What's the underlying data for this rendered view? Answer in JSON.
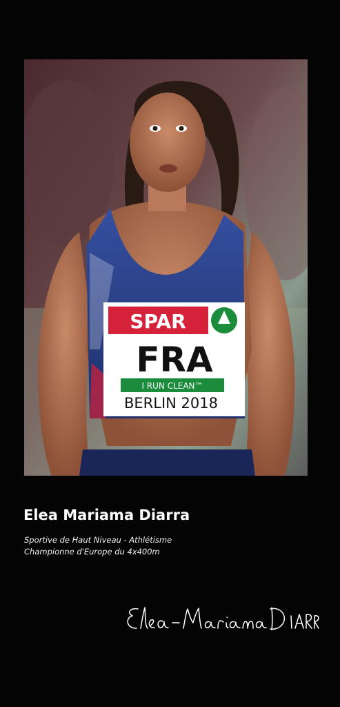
{
  "athlete": {
    "name": "Elea Mariama Diarra",
    "subtitle_line1": "Sportive de Haut Niveau - Athlétisme",
    "subtitle_line2": "Championne d'Europe du 4x400m"
  },
  "photo": {
    "description_icon": "athlete-portrait-image",
    "bib": {
      "sponsor": "SPAR",
      "country": "FRA",
      "slogan": "I RUN CLEAN™",
      "event": "BERLIN 2018"
    }
  },
  "signature": {
    "text": "Elea-Mariama Diarra"
  },
  "colors": {
    "background": "#040404",
    "text": "#ffffff",
    "jersey": "#2a3f86",
    "spar_red": "#d6213a",
    "spar_green": "#1a8c3c"
  }
}
